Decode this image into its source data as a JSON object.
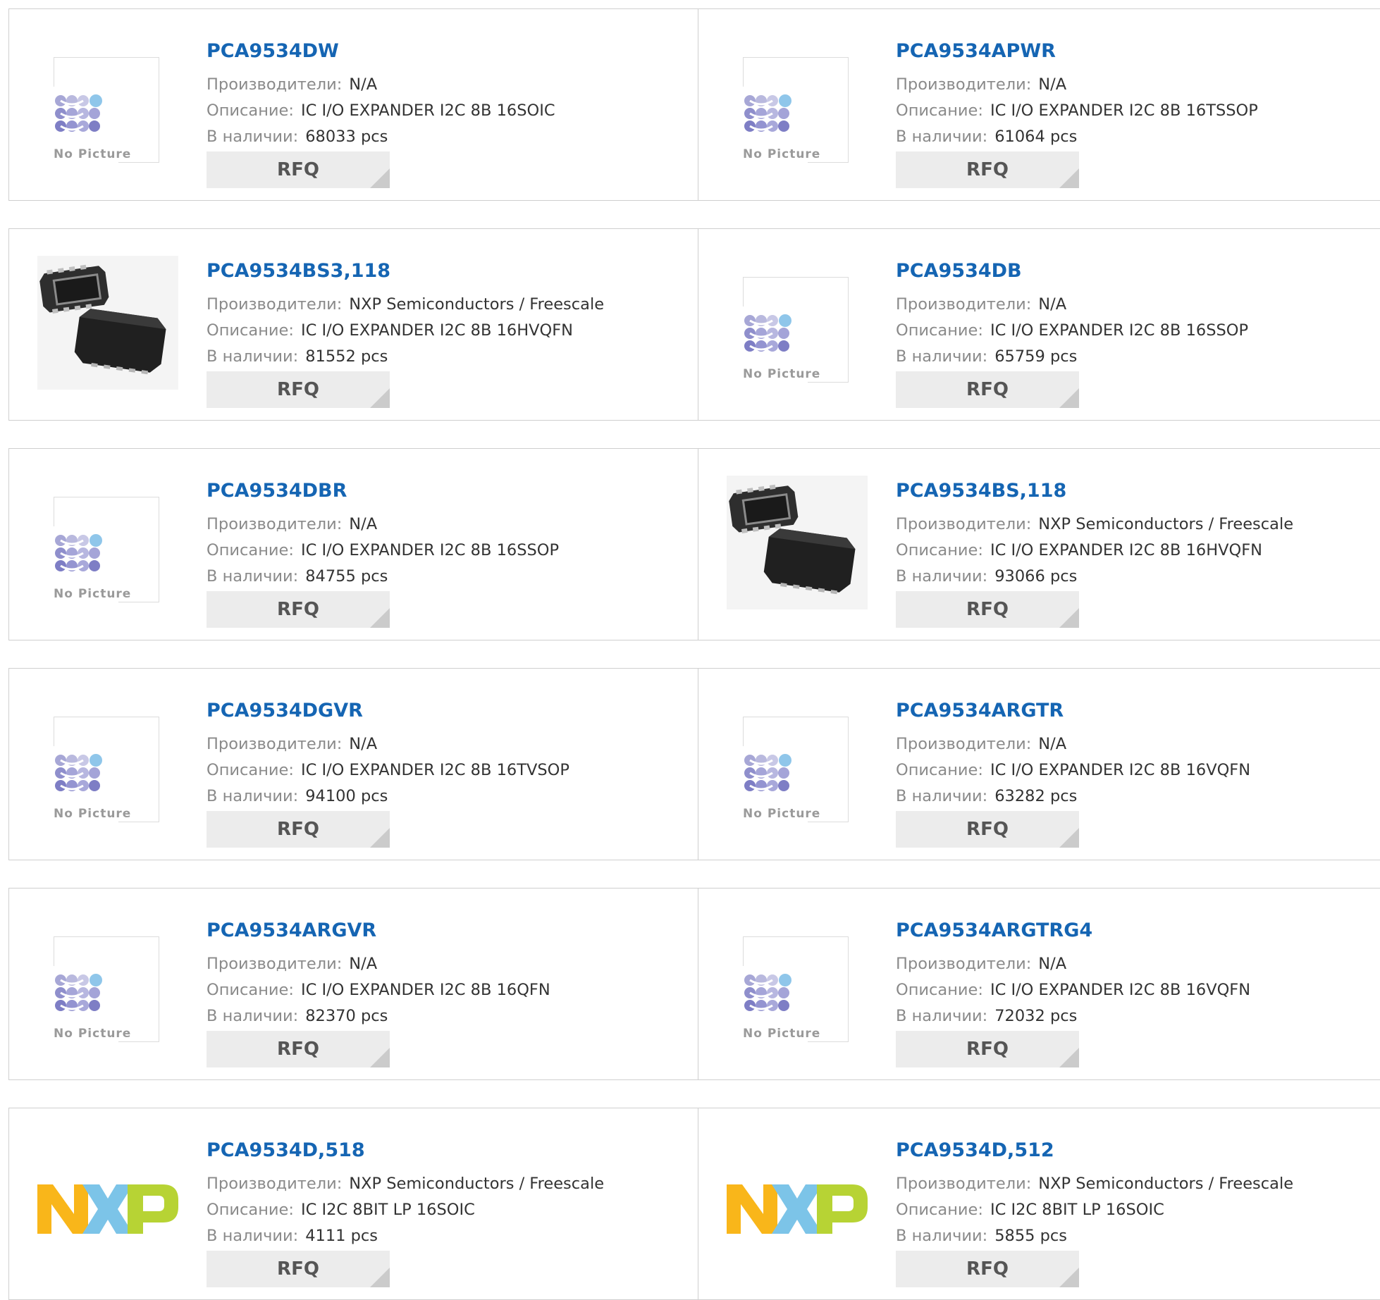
{
  "labels": {
    "manufacturer": "Производители:",
    "description": "Описание:",
    "stock": "В наличии:",
    "rfq": "RFQ",
    "no_picture": "No Picture"
  },
  "products": [
    {
      "part": "PCA9534DW",
      "manufacturer": "N/A",
      "description": "IC I/O EXPANDER I2C 8B 16SOIC",
      "stock": "68033 pcs",
      "image": "no-picture"
    },
    {
      "part": "PCA9534APWR",
      "manufacturer": "N/A",
      "description": "IC I/O EXPANDER I2C 8B 16TSSOP",
      "stock": "61064 pcs",
      "image": "no-picture"
    },
    {
      "part": "PCA9534BS3,118",
      "manufacturer": "NXP Semiconductors / Freescale",
      "description": "IC I/O EXPANDER I2C 8B 16HVQFN",
      "stock": "81552 pcs",
      "image": "chip"
    },
    {
      "part": "PCA9534DB",
      "manufacturer": "N/A",
      "description": "IC I/O EXPANDER I2C 8B 16SSOP",
      "stock": "65759 pcs",
      "image": "no-picture"
    },
    {
      "part": "PCA9534DBR",
      "manufacturer": "N/A",
      "description": "IC I/O EXPANDER I2C 8B 16SSOP",
      "stock": "84755 pcs",
      "image": "no-picture"
    },
    {
      "part": "PCA9534BS,118",
      "manufacturer": "NXP Semiconductors / Freescale",
      "description": "IC I/O EXPANDER I2C 8B 16HVQFN",
      "stock": "93066 pcs",
      "image": "chip"
    },
    {
      "part": "PCA9534DGVR",
      "manufacturer": "N/A",
      "description": "IC I/O EXPANDER I2C 8B 16TVSOP",
      "stock": "94100 pcs",
      "image": "no-picture"
    },
    {
      "part": "PCA9534ARGTR",
      "manufacturer": "N/A",
      "description": "IC I/O EXPANDER I2C 8B 16VQFN",
      "stock": "63282 pcs",
      "image": "no-picture"
    },
    {
      "part": "PCA9534ARGVR",
      "manufacturer": "N/A",
      "description": "IC I/O EXPANDER I2C 8B 16QFN",
      "stock": "82370 pcs",
      "image": "no-picture"
    },
    {
      "part": "PCA9534ARGTRG4",
      "manufacturer": "N/A",
      "description": "IC I/O EXPANDER I2C 8B 16VQFN",
      "stock": "72032 pcs",
      "image": "no-picture"
    },
    {
      "part": "PCA9534D,518",
      "manufacturer": "NXP Semiconductors / Freescale",
      "description": "IC I2C 8BIT LP 16SOIC",
      "stock": "4111 pcs",
      "image": "nxp-logo"
    },
    {
      "part": "PCA9534D,512",
      "manufacturer": "NXP Semiconductors / Freescale",
      "description": "IC I2C 8BIT LP 16SOIC",
      "stock": "5855 pcs",
      "image": "nxp-logo"
    }
  ]
}
